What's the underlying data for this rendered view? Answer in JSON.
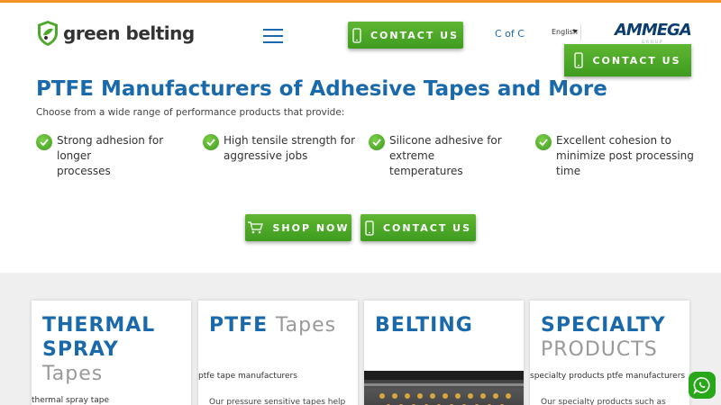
{
  "header": {
    "logo_text": "green belting",
    "contact_label": "CONTACT US",
    "cofc_label": "C of C",
    "language": "English",
    "partner_logo": "AMMEGA",
    "partner_sub": "GROUP",
    "floating_contact_label": "CONTACT US"
  },
  "hero": {
    "title": "PTFE Manufacturers of Adhesive Tapes and More",
    "intro": "Choose from a wide range of performance products that provide:",
    "features": [
      {
        "text": "Strong adhesion for\nlonger\nprocesses"
      },
      {
        "text": "High tensile strength for\naggressive jobs"
      },
      {
        "text": "Silicone adhesive for\nextreme\ntemperatures"
      },
      {
        "text": "Excellent cohesion to\nminimize post processing\ntime"
      }
    ],
    "shop_label": "SHOP NOW",
    "contact_label": "CONTACT US"
  },
  "cards": [
    {
      "title_bold_1": "THERMAL",
      "title_bold_2": "SPRAY",
      "title_light": "Tapes",
      "sub": "thermal spray tape"
    },
    {
      "title_bold": "PTFE",
      "title_light": "Tapes",
      "sub": "ptfe tape manufacturers",
      "body": "Our pressure sensitive tapes help"
    },
    {
      "title_bold": "BELTING"
    },
    {
      "title_bold": "SPECIALTY",
      "title_light": "PRODUCTS",
      "sub": "specialty products ptfe manufacturers",
      "body": "Our specialty products such as"
    }
  ],
  "icons": {
    "check": "check-icon",
    "phone": "mobile-phone-icon",
    "cart": "cart-icon",
    "whatsapp": "whatsapp-icon"
  },
  "colors": {
    "brand_blue": "#1a6aab",
    "brand_green": "#4ea82a",
    "accent_orange": "#f39325"
  }
}
